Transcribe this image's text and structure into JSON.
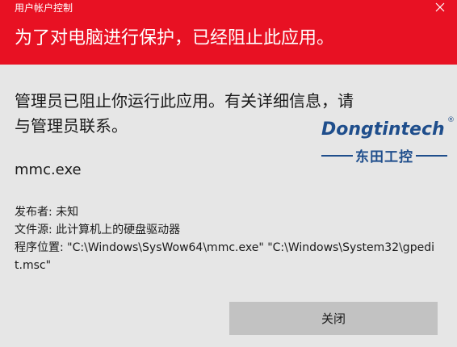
{
  "window": {
    "title": "用户帐户控制",
    "close_glyph": "×"
  },
  "header": {
    "headline": "为了对电脑进行保护，已经阻止此应用。"
  },
  "body": {
    "message": "管理员已阻止你运行此应用。有关详细信息，请与管理员联系。",
    "app_name": "mmc.exe",
    "publisher": "发布者: 未知",
    "file_source": "文件源: 此计算机上的硬盘驱动器",
    "program_location": "程序位置: \"C:\\Windows\\SysWow64\\mmc.exe\" \"C:\\Windows\\System32\\gpedit.msc\""
  },
  "buttons": {
    "close_label": "关闭"
  },
  "watermark": {
    "brand": "Dongtintech",
    "registered": "®",
    "subtitle": "东田工控"
  },
  "colors": {
    "header": "#e81123",
    "background": "#e6e6e6",
    "button": "#c2c2c2",
    "watermark": "#1f4e8c"
  }
}
